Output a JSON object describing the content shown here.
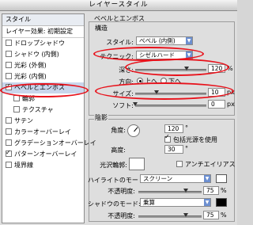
{
  "window": {
    "title": "レイヤースタイル"
  },
  "sidebar": {
    "header": "スタイル",
    "blend_options": "レイヤー効果: 初期設定",
    "items": [
      {
        "label": "ドロップシャドウ",
        "checked": false,
        "selected": false
      },
      {
        "label": "シャドウ (内側)",
        "checked": false,
        "selected": false
      },
      {
        "label": "光彩 (外側)",
        "checked": false,
        "selected": false
      },
      {
        "label": "光彩 (内側)",
        "checked": false,
        "selected": false
      },
      {
        "label": "ベベルとエンボス",
        "checked": true,
        "selected": true
      },
      {
        "label": "輪郭",
        "checked": false,
        "selected": false,
        "sub": true
      },
      {
        "label": "テクスチャ",
        "checked": false,
        "selected": false,
        "sub": true
      },
      {
        "label": "サテン",
        "checked": false,
        "selected": false
      },
      {
        "label": "カラーオーバーレイ",
        "checked": false,
        "selected": false
      },
      {
        "label": "グラデーションオーバーレイ",
        "checked": false,
        "selected": false
      },
      {
        "label": "パターンオーバーレイ",
        "checked": true,
        "selected": false
      },
      {
        "label": "境界線",
        "checked": false,
        "selected": false
      }
    ]
  },
  "bevel": {
    "section_title": "ベベルとエンボス",
    "structure_title": "構造",
    "style_label": "スタイル:",
    "style_value": "ベベル (内側)",
    "technique_label": "テクニック:",
    "technique_value": "シゼルハード",
    "depth_label": "深さ:",
    "depth_value": "120",
    "depth_unit": "%",
    "direction_label": "方向:",
    "direction_up": "上へ",
    "direction_down": "下へ",
    "size_label": "サイズ:",
    "size_value": "10",
    "size_unit": "px",
    "soften_label": "ソフト:",
    "soften_value": "0",
    "soften_unit": "px"
  },
  "shading": {
    "title": "陰影",
    "angle_label": "角度:",
    "angle_value": "120",
    "angle_unit": "°",
    "global_light_label": "包括光源を使用",
    "altitude_label": "高度:",
    "altitude_value": "30",
    "altitude_unit": "°",
    "gloss_label": "光沢輪郭:",
    "antialias_label": "アンチエイリアス",
    "highlight_mode_label": "ハイライトのモード:",
    "highlight_mode_value": "スクリーン",
    "highlight_opacity_label": "不透明度:",
    "highlight_opacity_value": "75",
    "highlight_opacity_unit": "%",
    "shadow_mode_label": "シャドウのモード:",
    "shadow_mode_value": "乗算",
    "shadow_opacity_label": "不透明度:",
    "shadow_opacity_value": "75",
    "shadow_opacity_unit": "%"
  },
  "colors": {
    "highlight_swatch": "#ffffff",
    "shadow_swatch": "#000000",
    "annotation": "#e8111a"
  },
  "levels": {
    "depth_fraction": 0.12,
    "size_fraction": 0.05,
    "soften_fraction": 0.0,
    "highlight_opacity": 75,
    "shadow_opacity": 75
  }
}
